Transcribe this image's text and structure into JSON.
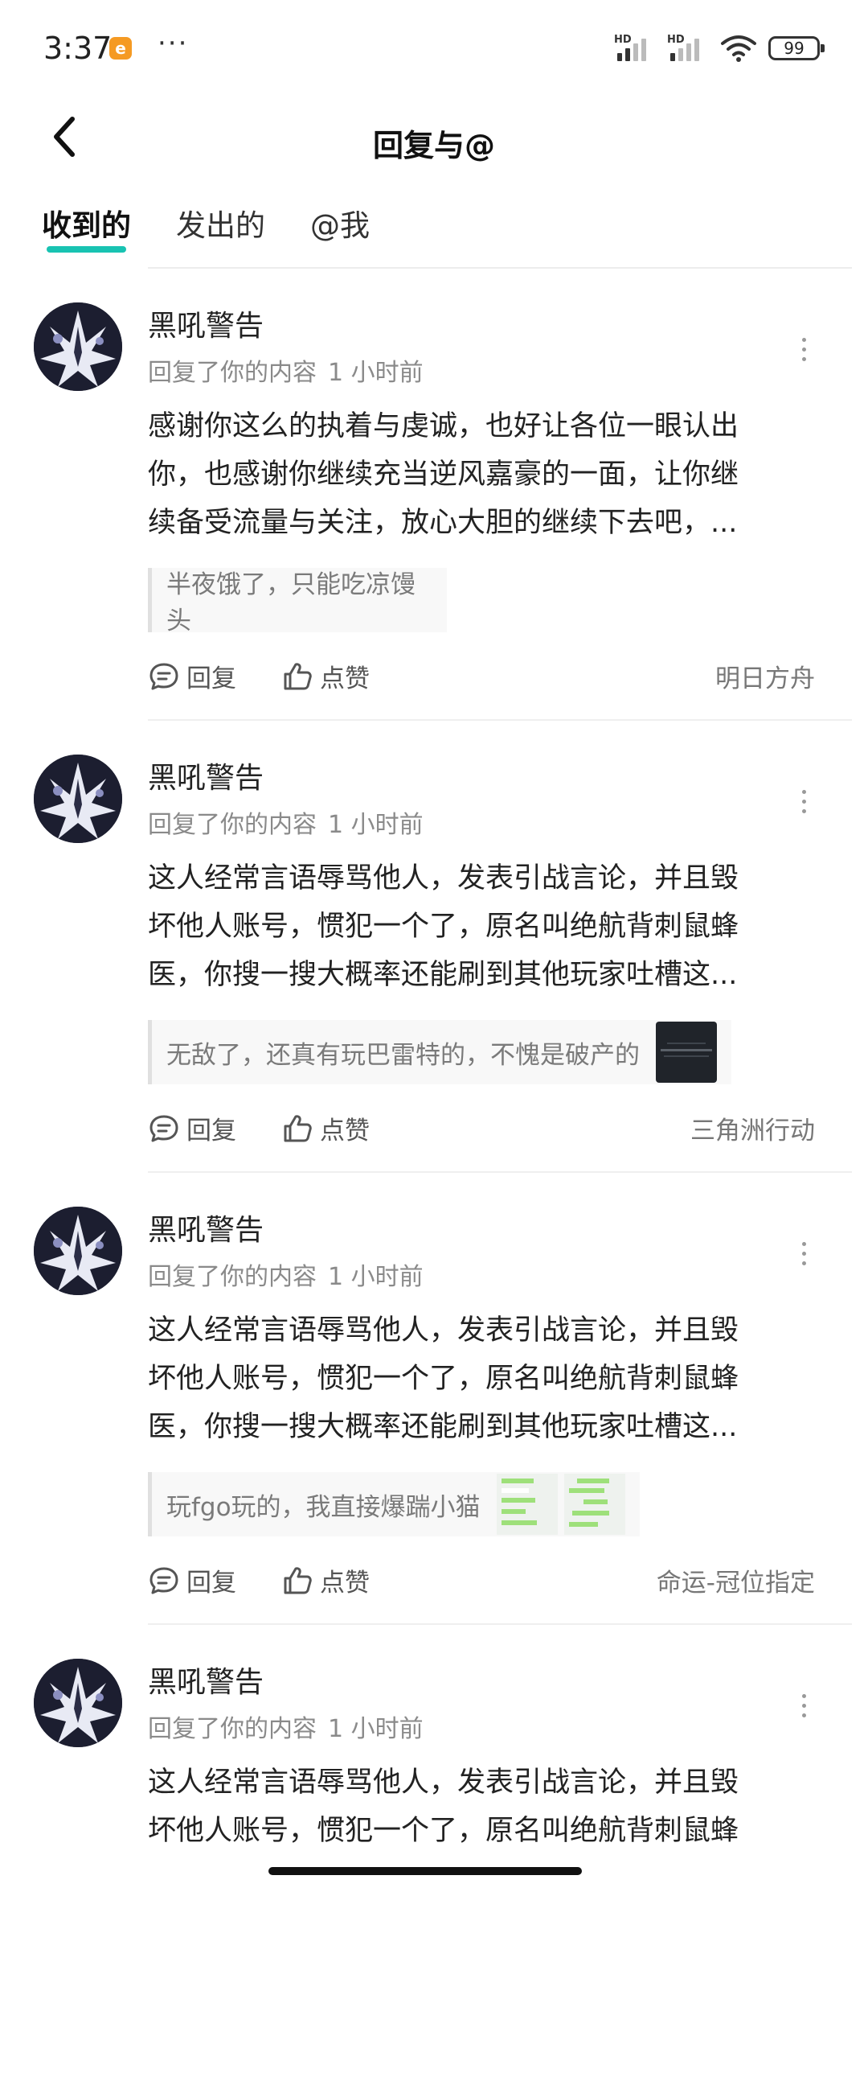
{
  "status_bar": {
    "time": "3:37",
    "app_icon": "e",
    "more": "···",
    "hd1": "HD",
    "hd2": "HD",
    "battery": "99"
  },
  "header": {
    "title": "回复与@"
  },
  "tabs": [
    {
      "label": "收到的",
      "active": true
    },
    {
      "label": "发出的",
      "active": false
    },
    {
      "label": "@我",
      "active": false
    }
  ],
  "accent_color": "#18c3b2",
  "items": [
    {
      "author": "黑吼警告",
      "action": "回复了你的内容",
      "time": "1 小时前",
      "content": [
        "感谢你这么的执着与虔诚，也好让各位一眼认出",
        "你，也感谢你继续充当逆风嘉豪的一面，让你继",
        "续备受流量与关注，放心大胆的继续下去吧，..."
      ],
      "quote": "半夜饿了，只能吃凉馒头",
      "reply_label": "回复",
      "like_label": "点赞",
      "source": "明日方舟"
    },
    {
      "author": "黑吼警告",
      "action": "回复了你的内容",
      "time": "1 小时前",
      "content": [
        "这人经常言语辱骂他人，发表引战言论，并且毁",
        "坏他人账号，惯犯一个了，原名叫绝航背刺鼠蜂",
        "医，你搜一搜大概率还能刷到其他玩家吐槽这..."
      ],
      "quote": "无敌了，还真有玩巴雷特的，不愧是破产的",
      "reply_label": "回复",
      "like_label": "点赞",
      "source": "三角洲行动"
    },
    {
      "author": "黑吼警告",
      "action": "回复了你的内容",
      "time": "1 小时前",
      "content": [
        "这人经常言语辱骂他人，发表引战言论，并且毁",
        "坏他人账号，惯犯一个了，原名叫绝航背刺鼠蜂",
        "医，你搜一搜大概率还能刷到其他玩家吐槽这..."
      ],
      "quote": "玩fgo玩的，我直接爆踹小猫",
      "reply_label": "回复",
      "like_label": "点赞",
      "source": "命运-冠位指定"
    },
    {
      "author": "黑吼警告",
      "action": "回复了你的内容",
      "time": "1 小时前",
      "content": [
        "这人经常言语辱骂他人，发表引战言论，并且毁",
        "坏他人账号，惯犯一个了，原名叫绝航背刺鼠蜂"
      ]
    }
  ]
}
